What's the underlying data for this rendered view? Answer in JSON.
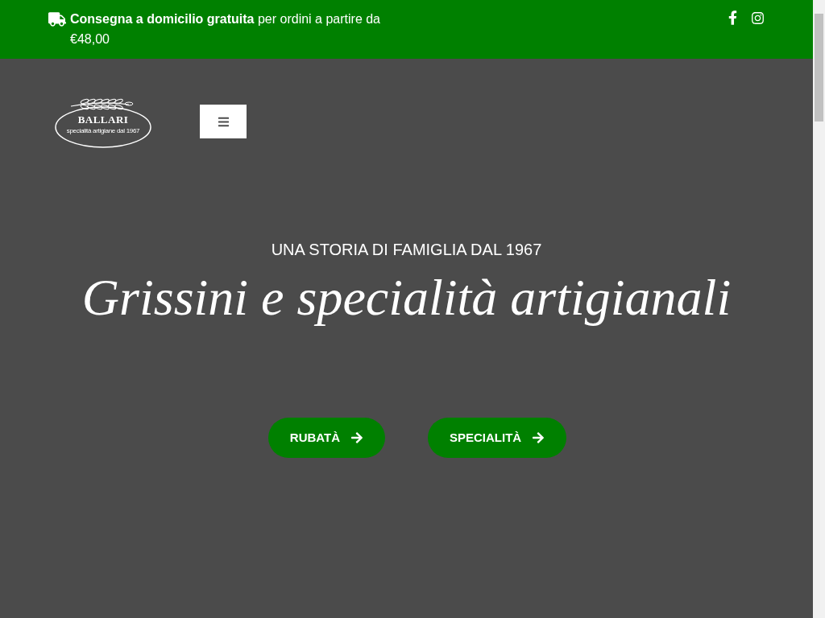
{
  "top_bar": {
    "notice": "**Consegna a domicilio gratuita** per ordini a partire da €48,00"
  },
  "header": {
    "logo": {
      "name": "BALLARI",
      "tagline": "specialità artigiane dal 1967"
    }
  },
  "hero": {
    "eyebrow": "UNA STORIA DI FAMIGLIA DAL 1967",
    "title": "Grissini e specialità artigianali",
    "buttons": [
      {
        "label": "RUBATÀ"
      },
      {
        "label": "SPECIALITÀ"
      }
    ]
  }
}
